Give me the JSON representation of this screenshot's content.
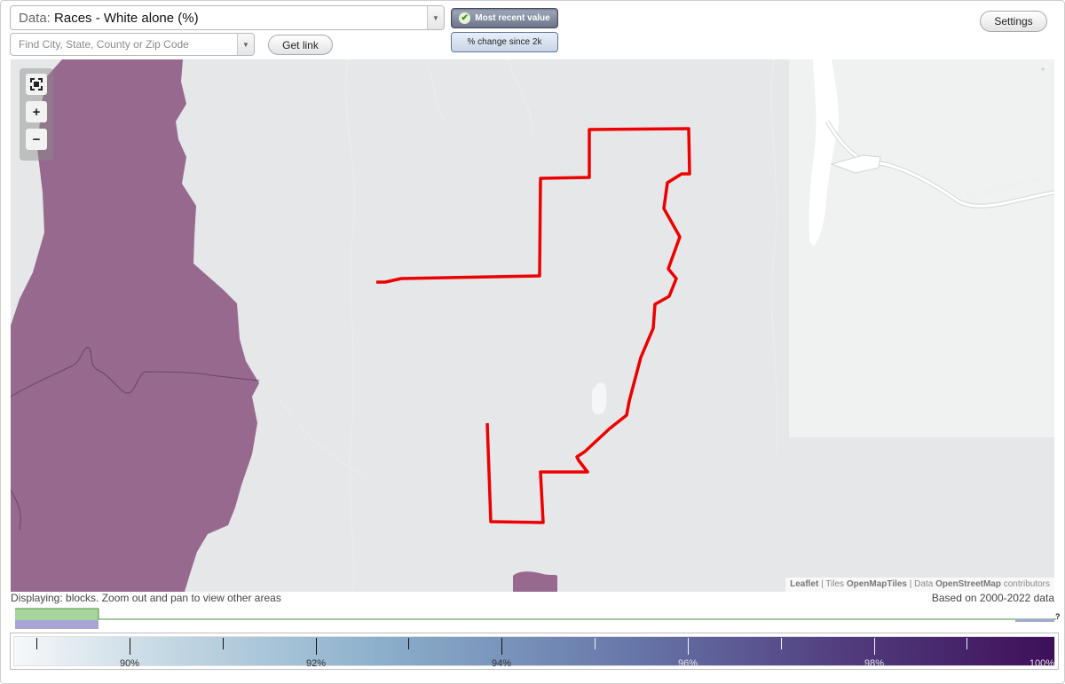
{
  "toolbar": {
    "data_label": "Data:",
    "data_value": "Races - White alone (%)",
    "search_placeholder": "Find City, State, County or Zip Code",
    "get_link": "Get link",
    "most_recent": "Most recent value",
    "pct_change": "% change since 2k",
    "settings": "Settings"
  },
  "map": {
    "zoom_in": "+",
    "zoom_out": "−",
    "road_label": "SILVER THREAD SCE",
    "attribution": {
      "leaflet": "Leaflet",
      "sep1": " | Tiles ",
      "tiles": "OpenMapTiles",
      "sep2": " | Data ",
      "data": "OpenStreetMap",
      "tail": " contributors"
    },
    "colors": {
      "block_fill": "#97698f",
      "boundary": "#ee0000",
      "land": "#e5e7e8",
      "park": "#eff2f1"
    }
  },
  "status": {
    "displaying": "Displaying: blocks. Zoom out and pan to view other areas",
    "based_on": "Based on 2000-2022 data"
  },
  "histogram": {
    "question_mark": "?"
  },
  "legend": {
    "labels": [
      "90%",
      "92%",
      "94%",
      "96%",
      "98%",
      "100%"
    ]
  }
}
